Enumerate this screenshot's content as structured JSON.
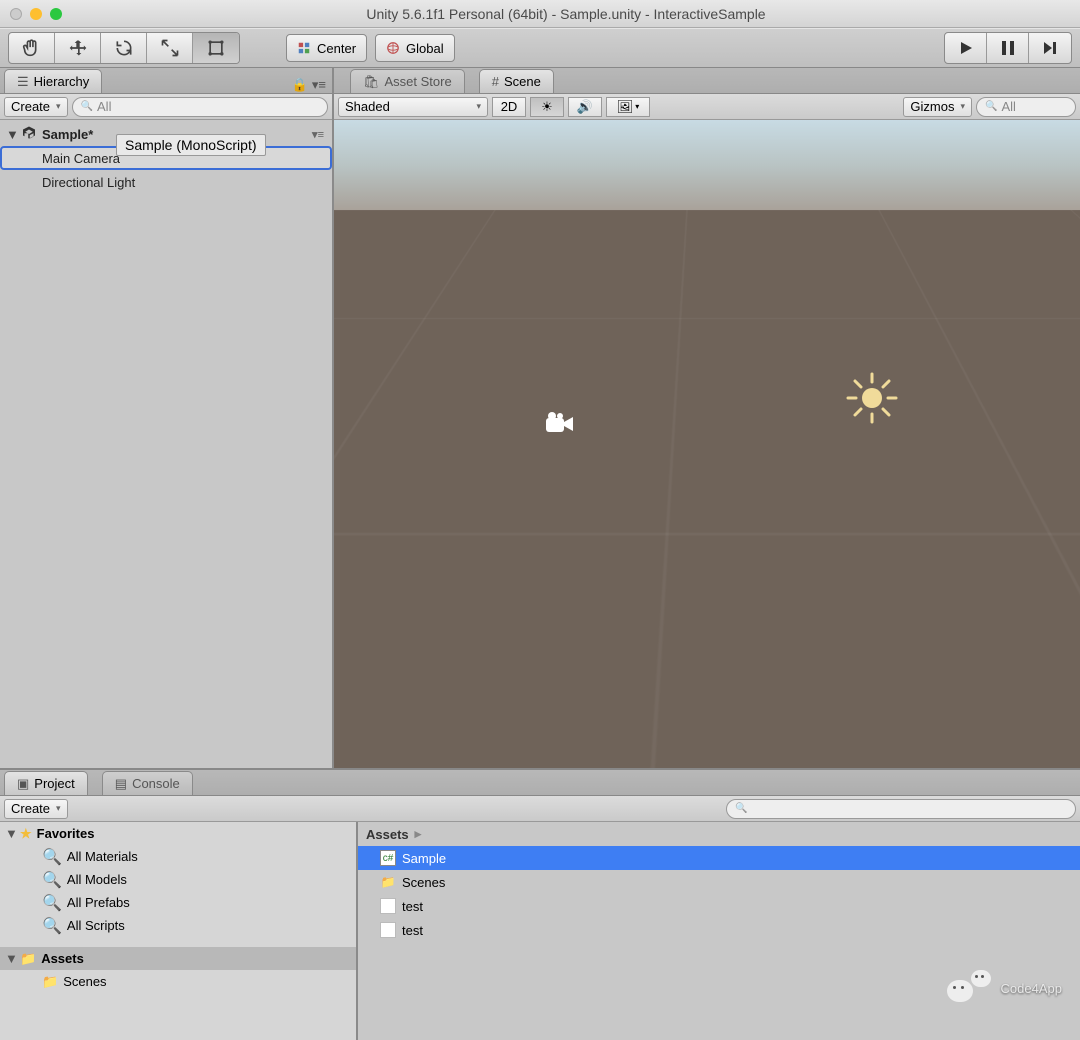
{
  "window": {
    "title": "Unity 5.6.1f1 Personal (64bit) - Sample.unity - InteractiveSample"
  },
  "toolbar": {
    "pivot_label": "Center",
    "space_label": "Global"
  },
  "hierarchy": {
    "tab_label": "Hierarchy",
    "create_label": "Create",
    "search_placeholder": "All",
    "scene_name": "Sample*",
    "tooltip": "Sample (MonoScript)",
    "items": [
      "Main Camera",
      "Directional Light"
    ],
    "selected_index": 0
  },
  "scene": {
    "tabs": [
      "Asset Store",
      "Scene"
    ],
    "active_tab": 1,
    "shading_label": "Shaded",
    "mode2d_label": "2D",
    "gizmos_label": "Gizmos",
    "search_placeholder": "All"
  },
  "project": {
    "tabs": [
      "Project",
      "Console"
    ],
    "active_tab": 0,
    "create_label": "Create",
    "favorites_label": "Favorites",
    "favorites": [
      "All Materials",
      "All Models",
      "All Prefabs",
      "All Scripts"
    ],
    "root_label": "Assets",
    "root_children": [
      "Scenes"
    ],
    "breadcrumb": "Assets",
    "assets": [
      {
        "name": "Sample",
        "type": "cs",
        "selected": true
      },
      {
        "name": "Scenes",
        "type": "folder"
      },
      {
        "name": "test",
        "type": "file"
      },
      {
        "name": "test",
        "type": "file"
      }
    ]
  },
  "watermark": "Code4App"
}
